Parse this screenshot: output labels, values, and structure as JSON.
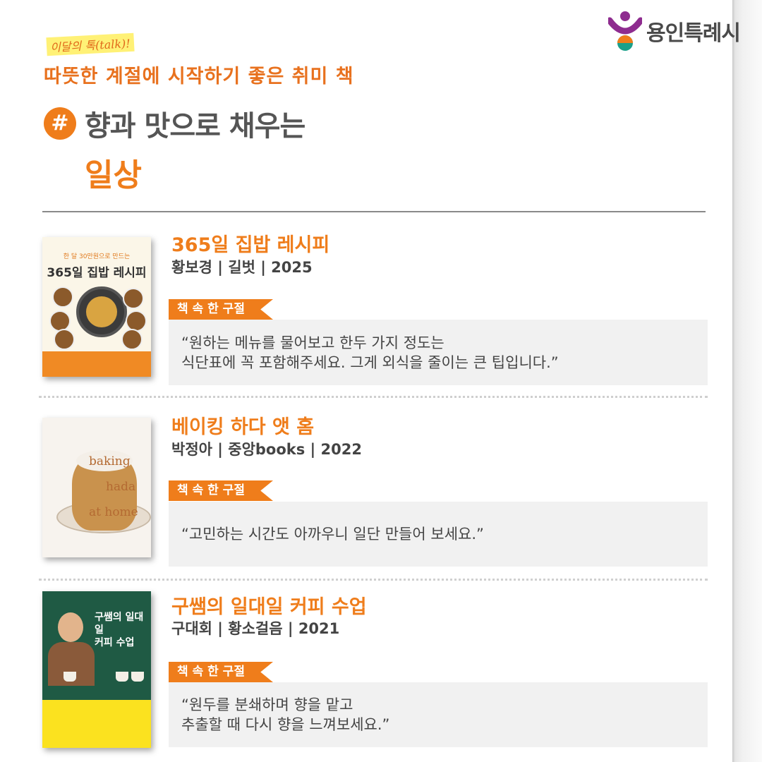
{
  "brand": {
    "name": "용인특례시",
    "colors": {
      "purple": "#8e2c8f",
      "orange": "#ef7d1b",
      "teal": "#1aa08a"
    }
  },
  "header": {
    "kicker": "이달의 톡(talk)!",
    "subtitle": "따뜻한 계절에 시작하기 좋은 취미 책",
    "hash": "#",
    "headline_line1": "향과 맛으로 채우는",
    "headline_line2": "일상"
  },
  "books": [
    {
      "title": "365일 집밥 레시피",
      "meta": "황보경 | 길벗 | 2025",
      "tag": "책 속 한 구절",
      "quote_lines": [
        "“원하는 메뉴를 물어보고 한두 가지 정도는",
        "식단표에 꼭 포함해주세요. 그게 외식을 줄이는 큰 팁입니다.”"
      ],
      "cover_text": {
        "top": "한 달 30만원으로 만드는",
        "title": "365일 집밥 레시피"
      }
    },
    {
      "title": "베이킹 하다 앳 홈",
      "meta": "박정아 | 중앙books | 2022",
      "tag": "책 속 한 구절",
      "quote_lines": [
        "“고민하는 시간도 아까우니 일단 만들어 보세요.”"
      ],
      "cover_text": {
        "w1": "baking",
        "w2": "hada",
        "w3": "at home"
      }
    },
    {
      "title": "구쌤의 일대일 커피 수업",
      "meta": "구대회 | 황소걸음 | 2021",
      "tag": "책 속 한 구절",
      "quote_lines": [
        "“원두를 분쇄하며 향을 맡고",
        "추출할 때 다시 향을 느껴보세요.”"
      ],
      "cover_text": {
        "line1": "구쌤의 일대일",
        "line2": "커피 수업"
      }
    }
  ]
}
